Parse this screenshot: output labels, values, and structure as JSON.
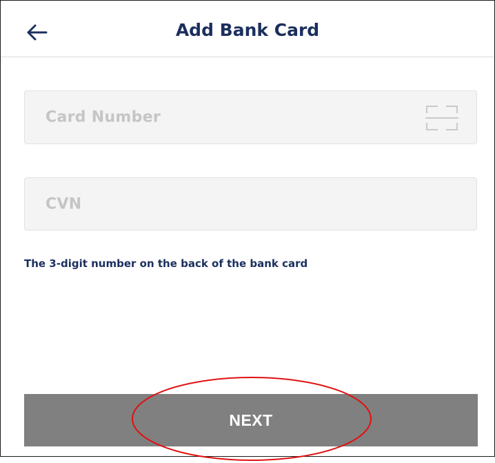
{
  "header": {
    "title": "Add Bank Card",
    "back_icon": "arrow-left-icon"
  },
  "form": {
    "card_number_placeholder": "Card Number",
    "scan_icon": "scan-frame-icon",
    "cvn_placeholder": "CVN",
    "cvn_hint": "The 3-digit number on the back of the bank card"
  },
  "actions": {
    "next_label": "NEXT"
  },
  "colors": {
    "title": "#1b2f5e",
    "placeholder": "#c5c5c5",
    "field_bg": "#f4f4f4",
    "button_bg": "#808080",
    "annotation": "#e01010"
  }
}
